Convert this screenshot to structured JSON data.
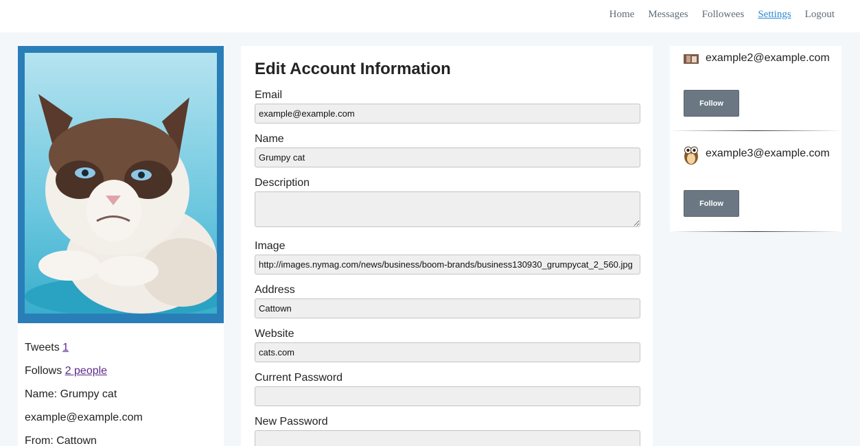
{
  "nav": {
    "items": [
      {
        "label": "Home"
      },
      {
        "label": "Messages"
      },
      {
        "label": "Followees"
      },
      {
        "label": "Settings",
        "active": true
      },
      {
        "label": "Logout"
      }
    ]
  },
  "profile": {
    "photo_icon": "grumpy-cat-photo",
    "tweets_label": "Tweets",
    "tweets_count": "1",
    "follows_label": "Follows",
    "follows_link": "2 people",
    "name_line": "Name: Grumpy cat",
    "email_line": "example@example.com",
    "from_line": "From: Cattown"
  },
  "form": {
    "title": "Edit Account Information",
    "email": {
      "label": "Email",
      "value": "example@example.com"
    },
    "name": {
      "label": "Name",
      "value": "Grumpy cat"
    },
    "description": {
      "label": "Description",
      "value": ""
    },
    "image": {
      "label": "Image",
      "value": "http://images.nymag.com/news/business/boom-brands/business130930_grumpycat_2_560.jpg"
    },
    "address": {
      "label": "Address",
      "value": "Cattown"
    },
    "website": {
      "label": "Website",
      "value": "cats.com"
    },
    "current_password": {
      "label": "Current Password",
      "value": ""
    },
    "new_password": {
      "label": "New Password",
      "value": ""
    }
  },
  "suggestions": [
    {
      "email": "example2@example.com",
      "button": "Follow",
      "avatar_icon": "cat-thumbnail"
    },
    {
      "email": "example3@example.com",
      "button": "Follow",
      "avatar_icon": "owl-icon"
    }
  ],
  "colors": {
    "accent": "#2a7eb8",
    "active_link": "#2b8ad1",
    "button": "#6b7883"
  }
}
